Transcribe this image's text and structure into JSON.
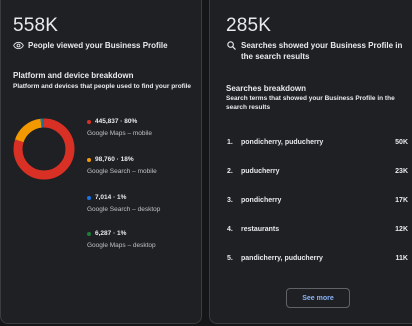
{
  "views": {
    "count": "558K",
    "caption": "People viewed your Business Profile",
    "icon": "eye-icon"
  },
  "platform": {
    "title": "Platform and device breakdown",
    "subtitle": "Platform and devices that people used to find your profile",
    "items": [
      {
        "value": "445,837 · 80%",
        "label": "Google Maps – mobile",
        "color": "#d93025",
        "fraction": 0.8
      },
      {
        "value": "98,760 · 18%",
        "label": "Google Search – mobile",
        "color": "#f29900",
        "fraction": 0.18
      },
      {
        "value": "7,014 · 1%",
        "label": "Google Search – desktop",
        "color": "#1a73e8",
        "fraction": 0.01
      },
      {
        "value": "6,287 · 1%",
        "label": "Google Maps – desktop",
        "color": "#188038",
        "fraction": 0.01
      }
    ]
  },
  "searches": {
    "count": "285K",
    "caption": "Searches showed your Business Profile in the search results",
    "icon": "search-icon"
  },
  "search_breakdown": {
    "title": "Searches breakdown",
    "subtitle": "Search terms that showed your Business Profile in the search results",
    "rows": [
      {
        "rank": "1.",
        "term": "pondicherry, puducherry",
        "count": "50K"
      },
      {
        "rank": "2.",
        "term": "puducherry",
        "count": "23K"
      },
      {
        "rank": "3.",
        "term": "pondicherry",
        "count": "17K"
      },
      {
        "rank": "4.",
        "term": "restaurants",
        "count": "12K"
      },
      {
        "rank": "5.",
        "term": "pandicherry, puducherry",
        "count": "11K"
      }
    ],
    "see_more": "See more"
  }
}
